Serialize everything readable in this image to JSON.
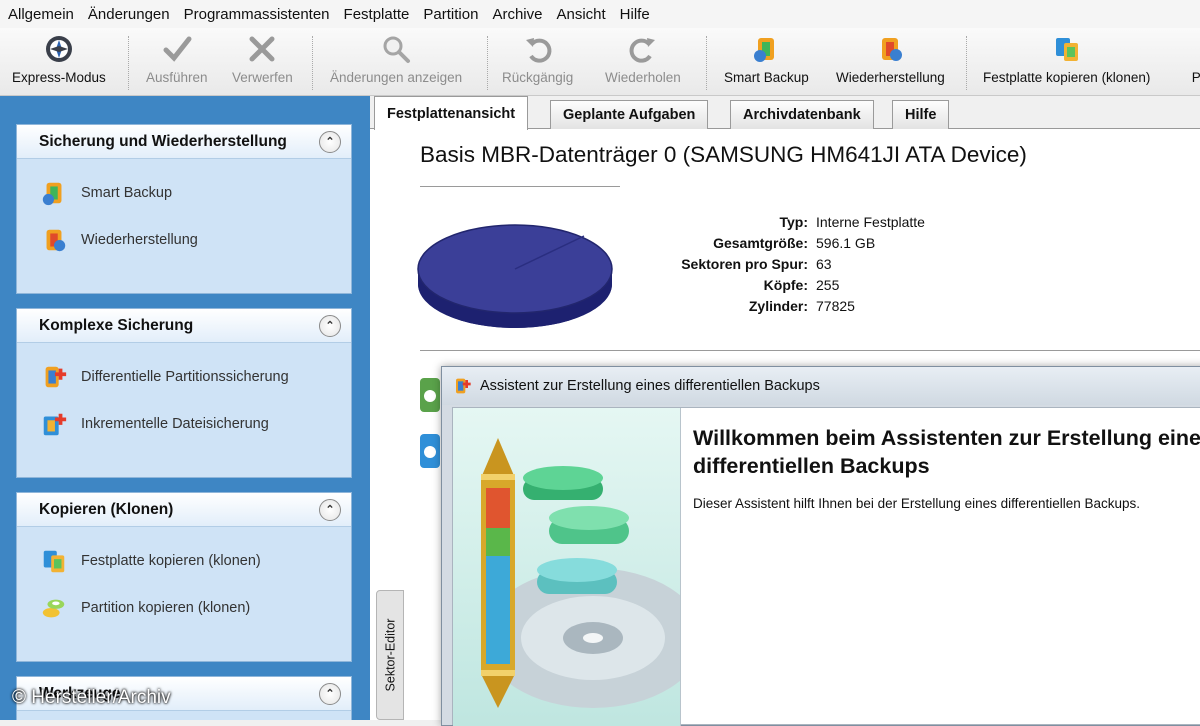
{
  "menu": [
    "Allgemein",
    "Änderungen",
    "Programmassistenten",
    "Festplatte",
    "Partition",
    "Archive",
    "Ansicht",
    "Hilfe"
  ],
  "toolbar": {
    "express": "Express-Modus",
    "execute": "Ausführen",
    "discard": "Verwerfen",
    "show_changes": "Änderungen anzeigen",
    "undo": "Rückgängig",
    "redo": "Wiederholen",
    "smart_backup": "Smart Backup",
    "restore": "Wiederherstellung",
    "clone_disk": "Festplatte kopieren (klonen)",
    "partition_cut": "Pa"
  },
  "sidebar": {
    "panels": [
      {
        "title": "Sicherung und Wiederherstellung",
        "items": [
          "Smart Backup",
          "Wiederherstellung"
        ]
      },
      {
        "title": "Komplexe Sicherung",
        "items": [
          "Differentielle Partitionssicherung",
          "Inkrementelle Dateisicherung"
        ]
      },
      {
        "title": "Kopieren (Klonen)",
        "items": [
          "Festplatte kopieren (klonen)",
          "Partition kopieren (klonen)"
        ]
      },
      {
        "title": "Werkzeuge",
        "items": []
      }
    ]
  },
  "tabs": [
    "Festplattenansicht",
    "Geplante Aufgaben",
    "Archivdatenbank",
    "Hilfe"
  ],
  "disk": {
    "title": "Basis MBR-Datenträger 0 (SAMSUNG HM641JI ATA Device)",
    "properties": [
      {
        "label": "Typ:",
        "value": "Interne Festplatte"
      },
      {
        "label": "Gesamtgröße:",
        "value": "596.1 GB"
      },
      {
        "label": "Sektoren pro Spur:",
        "value": "63"
      },
      {
        "label": "Köpfe:",
        "value": "255"
      },
      {
        "label": "Zylinder:",
        "value": "77825"
      }
    ]
  },
  "side_tab": "Sektor-Editor",
  "dialog": {
    "title": "Assistent zur Erstellung eines differentiellen Backups",
    "heading_line1": "Willkommen beim Assistenten zur Erstellung eines",
    "heading_line2": "differentiellen Backups",
    "description": "Dieser Assistent hilft Ihnen bei der Erstellung eines differentiellen Backups."
  },
  "watermark": "© Hersteller/Archiv",
  "colors": {
    "sidebar_bg": "#3e86c4",
    "panel_bg": "#cfe3f6",
    "disk_blue": "#3b3f98"
  }
}
